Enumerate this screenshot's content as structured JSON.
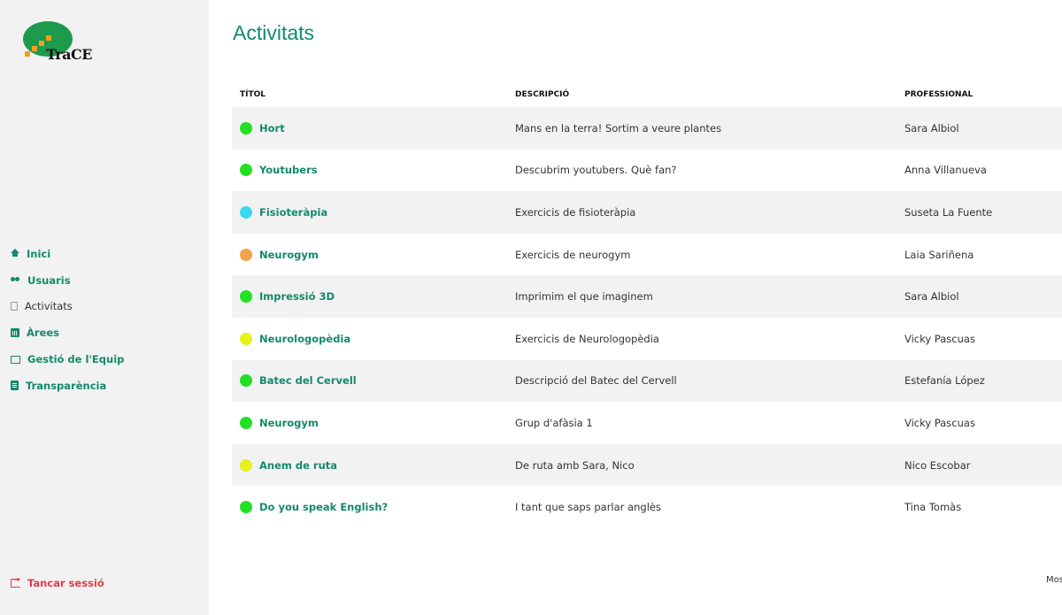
{
  "logo": {
    "text": "TraCE"
  },
  "nav": {
    "items": [
      {
        "label": "Inici",
        "icon": "home-icon"
      },
      {
        "label": "Usuaris",
        "icon": "users-icon"
      },
      {
        "label": "Activitats",
        "icon": "document-icon"
      },
      {
        "label": "Àrees",
        "icon": "calendar-icon"
      },
      {
        "label": "Gestió de l'Equip",
        "icon": "team-icon"
      },
      {
        "label": "Transparència",
        "icon": "file-icon"
      }
    ],
    "active": "Activitats",
    "logout": "Tancar sessió"
  },
  "page": {
    "title": "Activitats",
    "footer_partial": "Mos"
  },
  "table": {
    "headers": [
      "TÍTOL",
      "DESCRIPCIÓ",
      "PROFESSIONAL"
    ],
    "rows": [
      {
        "title": "Hort",
        "description": "Mans en la terra! Sortim a veure plantes",
        "professional": "Sara Albiol",
        "color": "#22e022"
      },
      {
        "title": "Youtubers",
        "description": "Descubrim youtubers. Què fan?",
        "professional": "Anna Villanueva",
        "color": "#22e022"
      },
      {
        "title": "Fisioteràpia",
        "description": "Exercicis de fisioteràpia",
        "professional": "Suseta La Fuente",
        "color": "#3ad8f0"
      },
      {
        "title": "Neurogym",
        "description": "Exercicis de neurogym",
        "professional": "Laia Sariñena",
        "color": "#f4a24a"
      },
      {
        "title": "Impressió 3D",
        "description": "Imprimim el que imaginem",
        "professional": "Sara Albiol",
        "color": "#22e022"
      },
      {
        "title": "Neurologopèdia",
        "description": "Exercicis de Neurologopèdia",
        "professional": "Vicky Pascuas",
        "color": "#e6f21a"
      },
      {
        "title": "Batec del Cervell",
        "description": "Descripció del Batec del Cervell",
        "professional": "Estefanía López",
        "color": "#22e022"
      },
      {
        "title": "Neurogym",
        "description": "Grup d'afàsia 1",
        "professional": "Vicky Pascuas",
        "color": "#22e022"
      },
      {
        "title": "Anem de ruta",
        "description": "De ruta amb Sara, Nico",
        "professional": "Nico Escobar",
        "color": "#e6f21a"
      },
      {
        "title": "Do you speak English?",
        "description": "I tant que saps parlar anglès",
        "professional": "Tina Tomàs",
        "color": "#22e022"
      }
    ]
  },
  "colors": {
    "accent": "#138a6c",
    "logout": "#e5394a",
    "sidebar_bg": "#f2f2f2"
  }
}
